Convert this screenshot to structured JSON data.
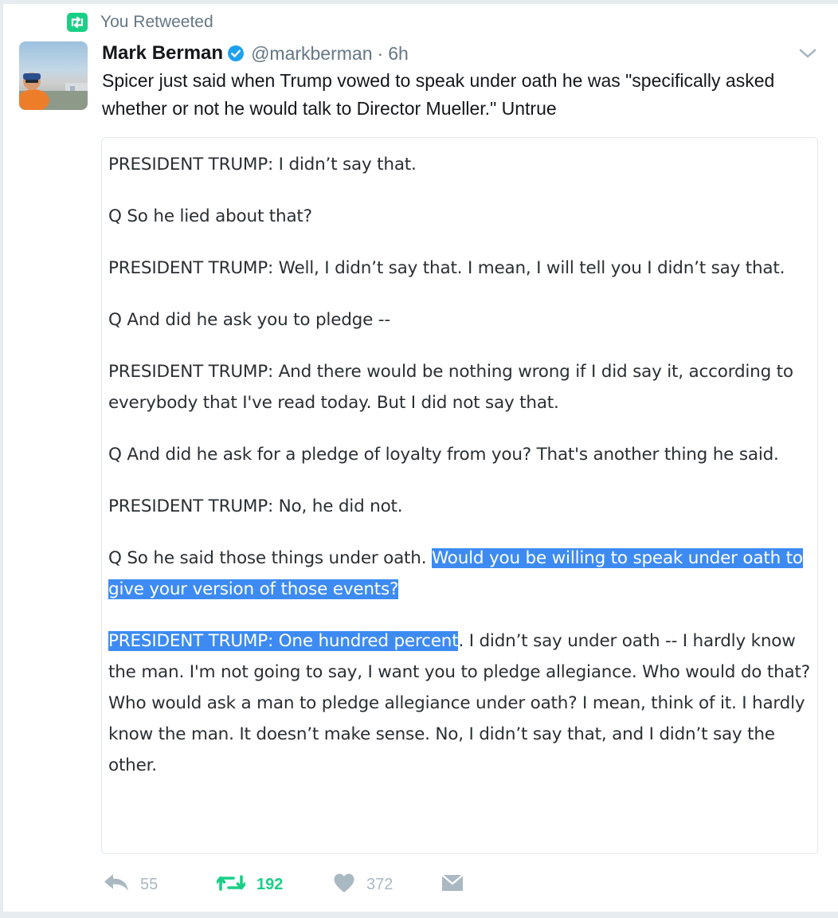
{
  "context": {
    "retweet_label": "You Retweeted"
  },
  "tweet": {
    "author_name": "Mark Berman",
    "handle": "@markberman",
    "separator": "·",
    "time": "6h",
    "text": "Spicer just said when Trump vowed to speak under oath he was \"specifically asked whether or not he would talk to Director Mueller.\" Untrue"
  },
  "transcript": {
    "p1": "PRESIDENT TRUMP:  I didn’t say that.",
    "p2": "Q   So he lied about that?",
    "p3": "PRESIDENT TRUMP:  Well, I didn’t say that.  I mean, I will tell you I didn’t say that.",
    "p4": "Q   And did he ask you to pledge --",
    "p5": "PRESIDENT TRUMP:  And there would be nothing wrong if I did say it, according to everybody that I've read today.  But I did not say that.",
    "p6": "Q   And did he ask for a pledge of loyalty from you?  That's another thing he said.",
    "p7": "PRESIDENT TRUMP:  No, he did not.",
    "p8_plain": "Q   So he said those things under oath. ",
    "p8_highlight": "Would you be willing to speak under oath to give your version of those events?",
    "p9_highlight": "PRESIDENT TRUMP:  One hundred percent",
    "p9_plain": ".  I didn’t say under oath -- I hardly know the man.  I'm not going to say, I want you to pledge allegiance.  Who would do that?  Who would ask a man to pledge allegiance under oath?  I mean, think of it.  I hardly know the man.  It doesn’t make sense.  No, I didn’t say that, and I didn’t say the other."
  },
  "actions": {
    "reply_count": "55",
    "retweet_count": "192",
    "like_count": "372"
  },
  "icons": {
    "retweet": "retweet-icon",
    "verified": "verified-badge-icon",
    "chevron": "chevron-down-icon",
    "reply": "reply-icon",
    "like": "heart-icon",
    "dm": "envelope-icon"
  },
  "colors": {
    "retweet_green": "#19cf86",
    "verified_blue": "#1da1f2",
    "highlight_blue": "#3d8bf2",
    "muted_gray": "#657786",
    "icon_gray": "#aab8c2"
  }
}
